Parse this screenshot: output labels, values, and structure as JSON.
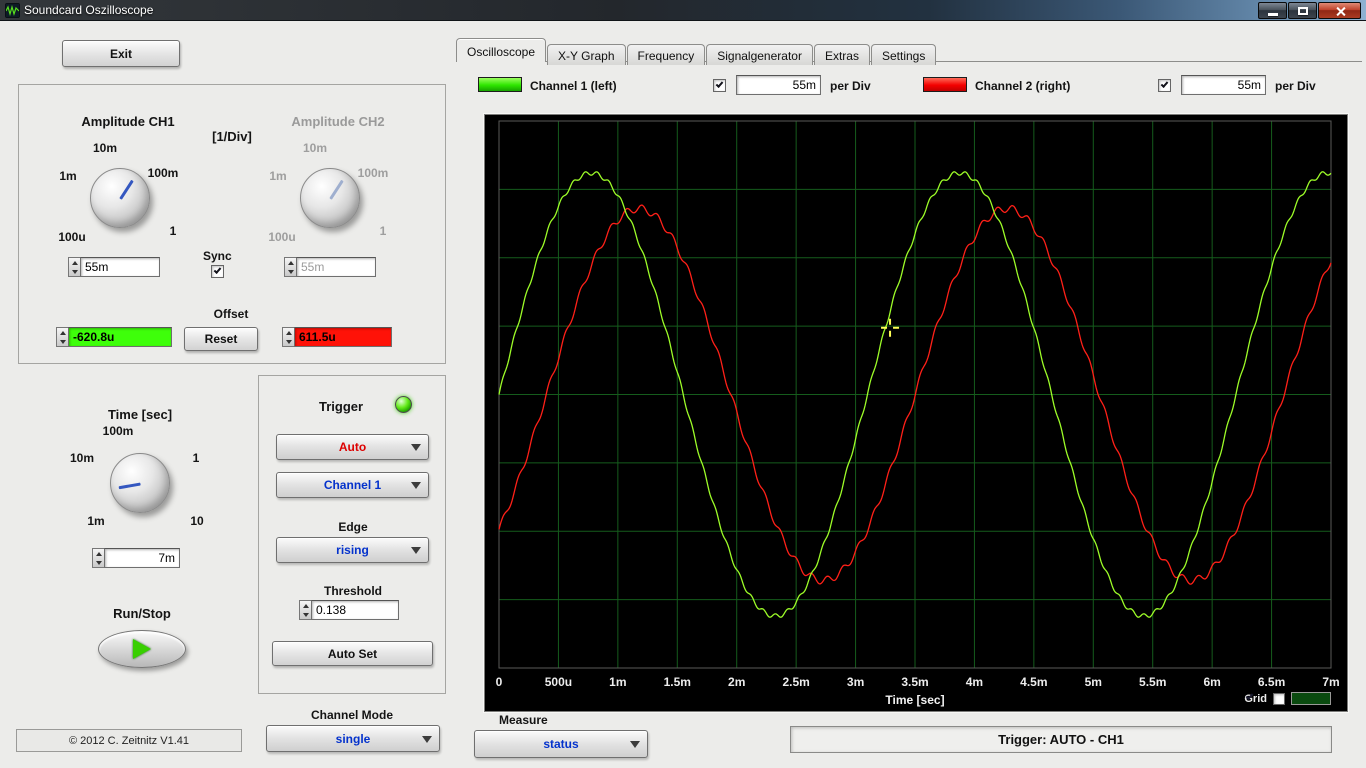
{
  "titlebar": {
    "title": "Soundcard Oszilloscope"
  },
  "left": {
    "exit": "Exit",
    "amp": {
      "ch1_title": "Amplitude CH1",
      "per_div": "[1/Div]",
      "ch2_title": "Amplitude CH2",
      "ticks": [
        "10m",
        "1m",
        "100m",
        "100u",
        "1"
      ],
      "ch1_value": "55m",
      "ch2_value": "55m",
      "sync": "Sync",
      "offset_title": "Offset",
      "offset_ch1": "-620.8u",
      "reset": "Reset",
      "offset_ch2": "611.5u"
    },
    "time": {
      "title": "Time [sec]",
      "ticks": [
        "100m",
        "10m",
        "1",
        "1m",
        "10"
      ],
      "value": "7m"
    },
    "run_stop": "Run/Stop",
    "copyright": "© 2012  C. Zeitnitz V1.41"
  },
  "trigger": {
    "title": "Trigger",
    "mode": "Auto",
    "source": "Channel 1",
    "edge_label": "Edge",
    "edge": "rising",
    "threshold_label": "Threshold",
    "threshold": "0.138",
    "auto_set": "Auto Set"
  },
  "channel_mode": {
    "label": "Channel Mode",
    "value": "single"
  },
  "tabs": {
    "items": [
      "Oscilloscope",
      "X-Y Graph",
      "Frequency",
      "Signalgenerator",
      "Extras",
      "Settings"
    ],
    "active": 0
  },
  "channel_bar": {
    "ch1_label": "Channel 1 (left)",
    "ch1_value": "55m",
    "ch1_unit": "per Div",
    "ch1_color": "#2ee600",
    "ch2_label": "Channel 2 (right)",
    "ch2_value": "55m",
    "ch2_unit": "per Div",
    "ch2_color": "#f40000"
  },
  "scope": {
    "x_ticks": [
      "0",
      "500u",
      "1m",
      "1.5m",
      "2m",
      "2.5m",
      "3m",
      "3.5m",
      "4m",
      "4.5m",
      "5m",
      "5.5m",
      "6m",
      "6.5m",
      "7m"
    ],
    "x_label": "Time [sec]",
    "grid_label": "Grid",
    "x_divisions": 14,
    "y_divisions": 8,
    "colors": {
      "ch1": "#9dfc28",
      "ch2": "#ff2018",
      "grid": "#155c1c",
      "frame": "#5a5a58",
      "grid_swatch": "#0a4a0f",
      "cursor": "#ffff55"
    },
    "wave": {
      "duration_ms": 7,
      "period_ms": 3.1,
      "ch1": {
        "phase_ms": 0.0,
        "amplitude": 0.81,
        "ripple": 0.01,
        "ripple_period_ms": 0.1
      },
      "ch2": {
        "phase_ms": 0.4,
        "amplitude": 0.68,
        "ripple": 0.02,
        "ripple_period_ms": 0.13
      }
    },
    "cursor": {
      "x_ms": 3.29,
      "y_frac": 0.378
    }
  },
  "measure": {
    "label": "Measure",
    "value": "status"
  },
  "status": "Trigger: AUTO - CH1"
}
